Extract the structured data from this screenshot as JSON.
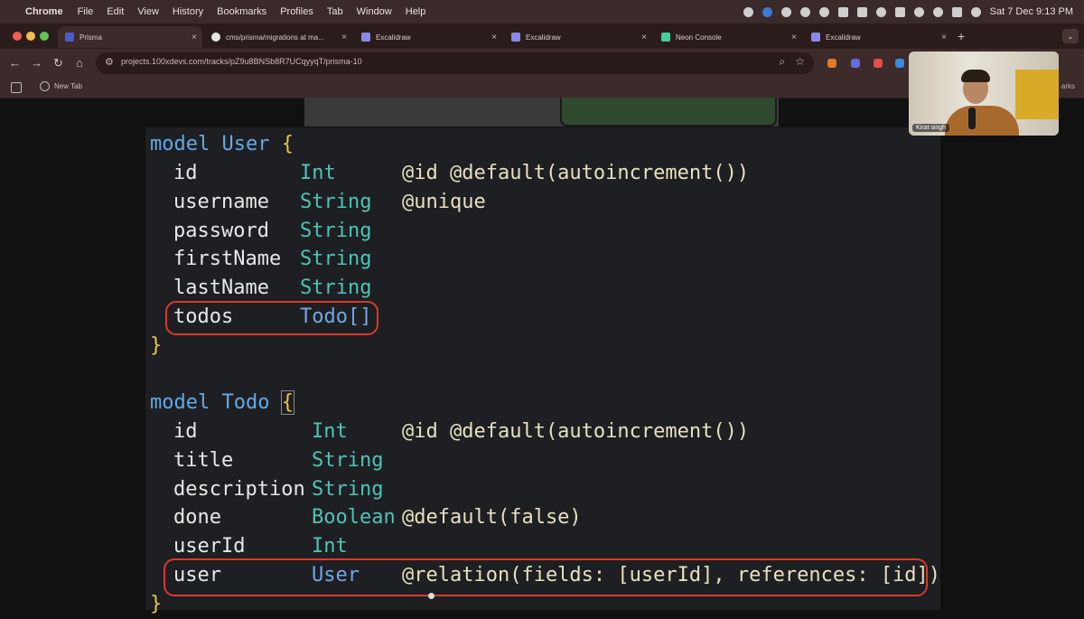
{
  "menubar": {
    "app_name": "Chrome",
    "items": [
      "File",
      "Edit",
      "View",
      "History",
      "Bookmarks",
      "Profiles",
      "Tab",
      "Window",
      "Help"
    ],
    "clock": "Sat 7 Dec  9:13 PM"
  },
  "tabs": [
    {
      "title": "Prisma",
      "active": true,
      "favicon_color": "#4a5cc9"
    },
    {
      "title": "cms/prisma/migrations at ma...",
      "active": false,
      "favicon_color": "#e6e6e6"
    },
    {
      "title": "Excalidraw",
      "active": false,
      "favicon_color": "#8a8ae6"
    },
    {
      "title": "Excalidraw",
      "active": false,
      "favicon_color": "#8a8ae6"
    },
    {
      "title": "Neon Console",
      "active": false,
      "favicon_color": "#3fd19a"
    },
    {
      "title": "Excalidraw",
      "active": false,
      "favicon_color": "#8a8ae6"
    }
  ],
  "toolbar": {
    "url": "projects.100xdevs.com/tracks/pZ9u8BNSb8R7UCqyyqT/prisma-10"
  },
  "bookmarks": {
    "items": [
      "New Tab"
    ],
    "right_label": "arks"
  },
  "webcam": {
    "name": "Kirat singh"
  },
  "code": {
    "user_model": {
      "keyword": "model",
      "name": "User",
      "open": "{",
      "close": "}",
      "fields": [
        {
          "name": "id",
          "type": "Int",
          "attr": "@id @default(autoincrement())"
        },
        {
          "name": "username",
          "type": "String",
          "attr": "@unique"
        },
        {
          "name": "password",
          "type": "String",
          "attr": ""
        },
        {
          "name": "firstName",
          "type": "String",
          "attr": ""
        },
        {
          "name": "lastName",
          "type": "String",
          "attr": ""
        },
        {
          "name": "todos",
          "type": "Todo[]",
          "attr": ""
        }
      ]
    },
    "todo_model": {
      "keyword": "model",
      "name": "Todo",
      "open": "{",
      "fields": [
        {
          "name": "id",
          "type": "Int",
          "attr": "@id @default(autoincrement())"
        },
        {
          "name": "title",
          "type": "String",
          "attr": ""
        },
        {
          "name": "description",
          "type": "String",
          "attr": ""
        },
        {
          "name": "done",
          "type": "Boolean",
          "attr": "@default(false)"
        },
        {
          "name": "userId",
          "type": "Int",
          "attr": ""
        },
        {
          "name": "user",
          "type": "User",
          "attr": "@relation(fields: [userId], references: [id])"
        }
      ]
    }
  },
  "colors": {
    "highlight": "#d93a2c",
    "editor_bg": "#1e1f22",
    "keyword": "#62a9e8",
    "type": "#4fc3b7",
    "brace": "#e8c84a"
  }
}
